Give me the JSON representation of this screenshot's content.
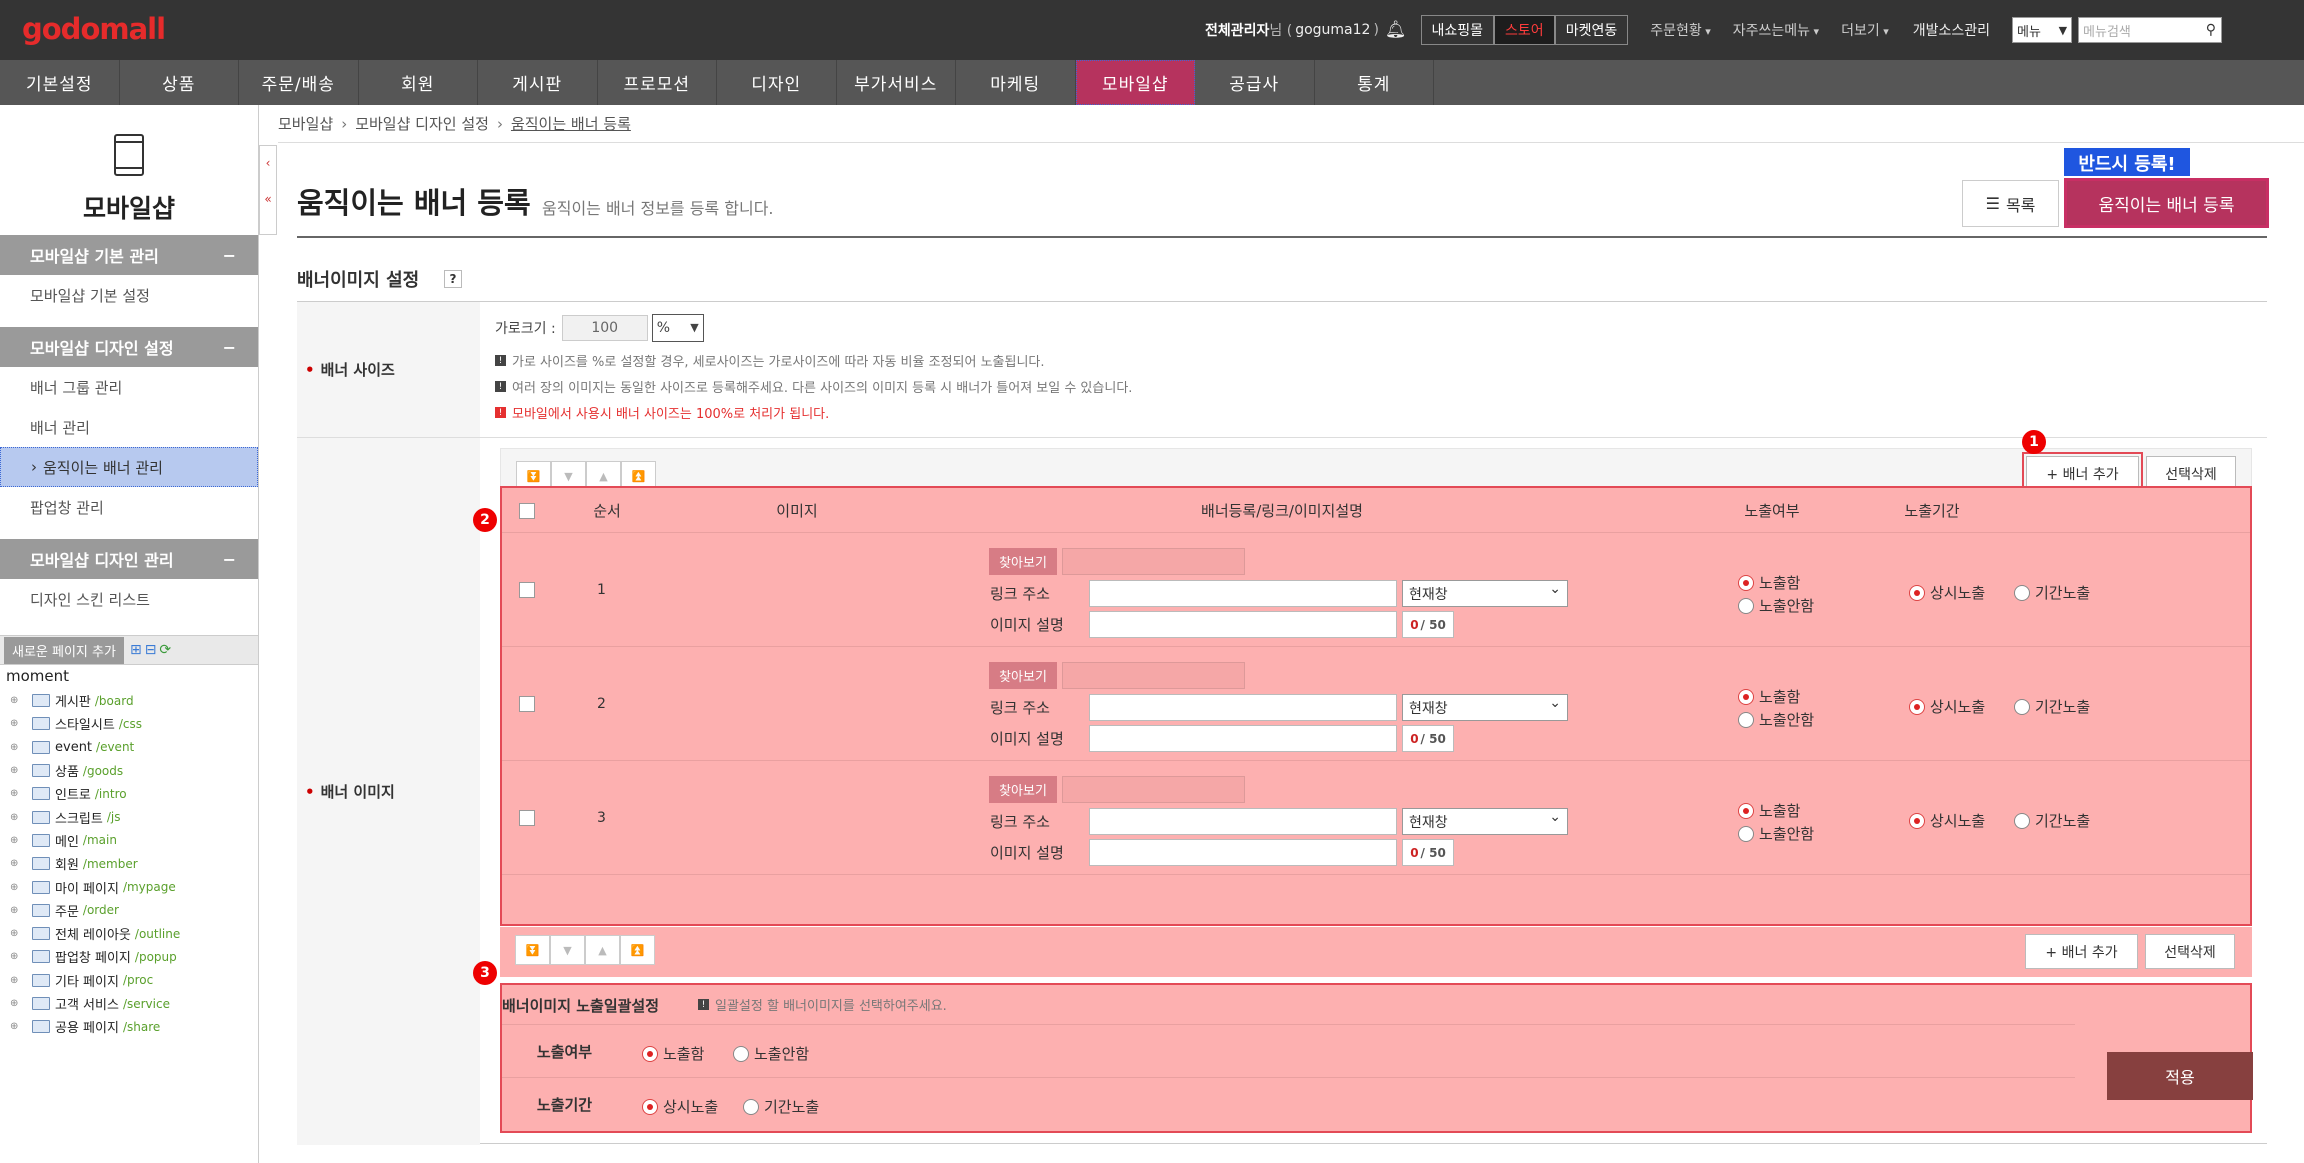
{
  "top": {
    "logo": "godomall",
    "admin_name": "전체관리자",
    "admin_suffix": "님 (",
    "admin_id": "goguma12",
    "admin_close": ")",
    "buttons": [
      "내쇼핑몰",
      "스토어",
      "마켓연동"
    ],
    "dropdowns": [
      "주문현황",
      "자주쓰는메뉴",
      "더보기"
    ],
    "dev_link": "개발소스관리",
    "menu_select": "메뉴",
    "search_placeholder": "메뉴검색"
  },
  "nav": [
    "기본설정",
    "상품",
    "주문/배송",
    "회원",
    "게시판",
    "프로모션",
    "디자인",
    "부가서비스",
    "마케팅",
    "모바일샵",
    "공급사",
    "통계"
  ],
  "sidebar": {
    "title": "모바일샵",
    "sections": [
      {
        "label": "모바일샵 기본 관리",
        "items": [
          "모바일샵 기본 설정"
        ]
      },
      {
        "label": "모바일샵 디자인 설정",
        "items": [
          "배너 그룹 관리",
          "배너 관리",
          "움직이는 배너 관리",
          "팝업창 관리"
        ]
      },
      {
        "label": "모바일샵 디자인 관리",
        "items": [
          "디자인 스킨 리스트"
        ]
      }
    ],
    "add_page": "새로운 페이지 추가",
    "tree_root": "moment",
    "tree": [
      {
        "name": "게시판",
        "path": "/board"
      },
      {
        "name": "스타일시트",
        "path": "/css"
      },
      {
        "name": "event",
        "path": "/event"
      },
      {
        "name": "상품",
        "path": "/goods"
      },
      {
        "name": "인트로",
        "path": "/intro"
      },
      {
        "name": "스크립트",
        "path": "/js"
      },
      {
        "name": "메인",
        "path": "/main"
      },
      {
        "name": "회원",
        "path": "/member"
      },
      {
        "name": "마이 페이지",
        "path": "/mypage"
      },
      {
        "name": "주문",
        "path": "/order"
      },
      {
        "name": "전체 레이아웃",
        "path": "/outline"
      },
      {
        "name": "팝업창 페이지",
        "path": "/popup"
      },
      {
        "name": "기타 페이지",
        "path": "/proc"
      },
      {
        "name": "고객 서비스",
        "path": "/service"
      },
      {
        "name": "공용 페이지",
        "path": "/share"
      }
    ]
  },
  "breadcrumb": [
    "모바일샵",
    "모바일샵 디자인 설정",
    "움직이는 배너 등록"
  ],
  "page": {
    "title": "움직이는 배너 등록",
    "subtitle": "움직이는 배너 정보를 등록 합니다.",
    "list_btn": "목록",
    "register_btn": "움직이는 배너 등록",
    "must_badge": "반드시 등록!",
    "section_title": "배너이미지 설정",
    "help": "?"
  },
  "size": {
    "label": "배너 사이즈",
    "width_label": "가로크기 :",
    "width_value": "100",
    "unit": "%",
    "notes": [
      "가로 사이즈를 %로 설정할 경우, 세로사이즈는 가로사이즈에 따라 자동 비율 조정되어 노출됩니다.",
      "여러 장의 이미지는 동일한 사이즈로 등록해주세요. 다른 사이즈의 이미지 등록 시 배너가 틀어져 보일 수 있습니다.",
      "모바일에서 사용시 배너 사이즈는 100%로 처리가 됩니다."
    ]
  },
  "banner": {
    "label": "배너 이미지",
    "add_btn": "+ 배너 추가",
    "del_btn": "선택삭제",
    "headers": [
      "순서",
      "이미지",
      "배너등록/링크/이미지설명",
      "노출여부",
      "노출기간"
    ],
    "find_btn": "찾아보기",
    "link_label": "링크 주소",
    "desc_label": "이미지 설명",
    "target": "현재창",
    "count": "0",
    "max": "/ 50",
    "show_on": "노출함",
    "show_off": "노출안함",
    "period_always": "상시노출",
    "period_range": "기간노출",
    "rows": [
      "1",
      "2",
      "3"
    ]
  },
  "bulk": {
    "title": "배너이미지 노출일괄설정",
    "note": "일괄설정 할 배너이미지를 선택하여주세요.",
    "show_label": "노출여부",
    "period_label": "노출기간",
    "show_on": "노출함",
    "show_off": "노출안함",
    "period_always": "상시노출",
    "period_range": "기간노출",
    "apply": "적용"
  },
  "markers": [
    "1",
    "2",
    "3"
  ],
  "colors": {
    "accent": "#b6335e",
    "highlight": "#fdb0b0",
    "badge": "#1f56e0"
  }
}
